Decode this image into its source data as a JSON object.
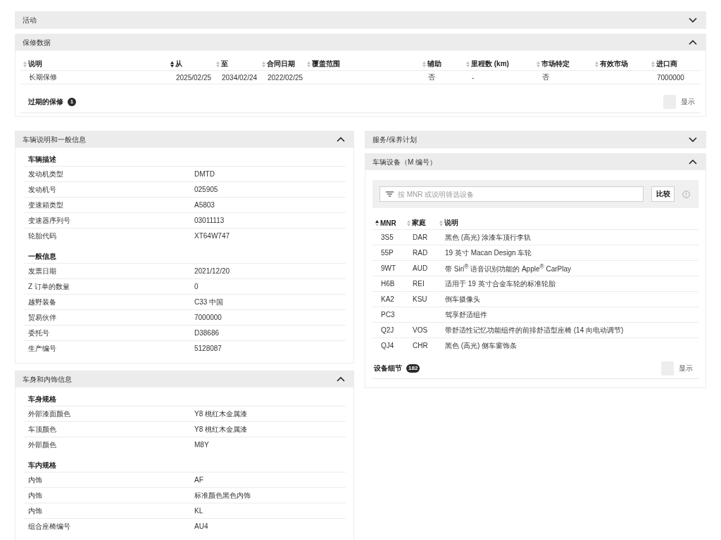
{
  "top_panels": [
    {
      "kind": "plain",
      "title": "活动",
      "expanded": false
    },
    {
      "kind": "warranty",
      "title": "保修数据",
      "expanded": true,
      "columns": [
        {
          "label": "说明",
          "sorted": false
        },
        {
          "label": "从",
          "sorted": true
        },
        {
          "label": "至",
          "sorted": false
        },
        {
          "label": "合同日期",
          "sorted": false
        },
        {
          "label": "覆盖范围",
          "sorted": false
        },
        {
          "label": "辅助",
          "sorted": false
        },
        {
          "label": "里程数 (km)",
          "sorted": false
        },
        {
          "label": "市场特定",
          "sorted": false
        },
        {
          "label": "有效市场",
          "sorted": false
        },
        {
          "label": "进口商",
          "sorted": false
        }
      ],
      "rows": [
        {
          "cells": [
            "长期保修",
            "2025/02/25",
            "2034/02/24",
            "2022/02/25",
            null,
            "否",
            "-",
            "否",
            null,
            "7000000"
          ]
        }
      ],
      "footer": {
        "label": "过期的保修",
        "count": "1",
        "toggle": {
          "label": "显示",
          "on": false
        }
      }
    }
  ],
  "left_panels": [
    {
      "kind": "details",
      "title": "车辆说明和一般信息",
      "expanded": true,
      "groups": [
        {
          "heading": "车辆描述",
          "rows": [
            {
              "label": "发动机类型",
              "value": "DMTD"
            },
            {
              "label": "发动机号",
              "value": "025905"
            },
            {
              "label": "变速箱类型",
              "value": "A5803"
            },
            {
              "label": "变速器序列号",
              "value": "03011113"
            },
            {
              "label": "轮胎代码",
              "value": "XT64W747"
            }
          ]
        },
        {
          "heading": "一般信息",
          "rows": [
            {
              "label": "发票日期",
              "value": "2021/12/20"
            },
            {
              "label": "Z 订单的数量",
              "value": "0"
            },
            {
              "label": "越野装备",
              "value": "C33 中国"
            },
            {
              "label": "贸易伙伴",
              "value": "7000000"
            },
            {
              "label": "委托号",
              "value": "D38686"
            },
            {
              "label": "生产编号",
              "value": "5128087"
            }
          ]
        }
      ]
    },
    {
      "kind": "details",
      "title": "车身和内饰信息",
      "expanded": true,
      "groups": [
        {
          "heading": "车身规格",
          "rows": [
            {
              "label": "外部漆面颜色",
              "value": "Y8 桃红木金属漆"
            },
            {
              "label": "车顶颜色",
              "value": "Y8 桃红木金属漆"
            },
            {
              "label": "外部颜色",
              "value": "M8Y"
            }
          ]
        },
        {
          "heading": "车内规格",
          "rows": [
            {
              "label": "内饰",
              "value": "AF"
            },
            {
              "label": "内饰",
              "value": "标准颜色黑色内饰"
            },
            {
              "label": "内饰",
              "value": "KL"
            },
            {
              "label": "组合座椅编号",
              "value": "AU4"
            }
          ]
        }
      ]
    }
  ],
  "right_panels": [
    {
      "kind": "plain",
      "title": "服务/保养计划",
      "expanded": false
    },
    {
      "kind": "equipment",
      "title": "车辆设备（M 编号）",
      "expanded": true,
      "filter": {
        "placeholder": "按 MNR 或说明筛选设备"
      },
      "compare_button": "比较",
      "columns": [
        {
          "label": "MNR",
          "sorted": true
        },
        {
          "label": "家庭",
          "sorted": false
        },
        {
          "label": "说明",
          "sorted": false
        }
      ],
      "rows": [
        {
          "cells": [
            "3S5",
            "DAR",
            "黑色 (高光) 涂漆车顶行李轨"
          ]
        },
        {
          "cells": [
            "55P",
            "RAD",
            "19 英寸 Macan Design 车轮"
          ]
        },
        {
          "cells": [
            "9WT",
            "AUD",
            "带 Siri$^{®}$ 语音识别功能的 Apple$^{®}$ CarPlay"
          ]
        },
        {
          "cells": [
            "H6B",
            "REI",
            "适用于 19 英寸合金车轮的标准轮胎"
          ]
        },
        {
          "cells": [
            "KA2",
            "KSU",
            "倒车摄像头"
          ]
        },
        {
          "cells": [
            "PC3",
            null,
            "驾享舒适组件"
          ]
        },
        {
          "cells": [
            "Q2J",
            "VOS",
            "带舒适性记忆功能组件的前排舒适型座椅 (14 向电动调节)"
          ]
        },
        {
          "cells": [
            "QJ4",
            "CHR",
            "黑色 (高光) 侧车窗饰条"
          ]
        }
      ],
      "footer": {
        "label": "设备细节",
        "count": "182",
        "toggle": {
          "label": "显示",
          "on": false
        }
      }
    }
  ]
}
